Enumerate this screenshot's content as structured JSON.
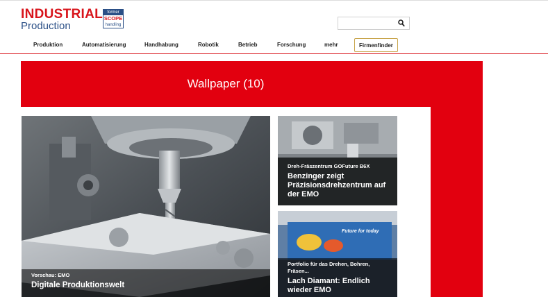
{
  "header": {
    "logo": {
      "line1": "INDUSTRIAL",
      "line2": "Production",
      "badge_top": "former",
      "badge_mid": "SCOPE",
      "badge_bottom": "handling"
    },
    "search": {
      "placeholder": "",
      "icon": "search-icon"
    },
    "nav": [
      "Produktion",
      "Automatisierung",
      "Handhabung",
      "Robotik",
      "Betrieb",
      "Forschung",
      "mehr"
    ],
    "firmenfinder_label": "Firmenfinder"
  },
  "section": {
    "title": "Wallpaper (10)"
  },
  "cards": {
    "main": {
      "kicker": "Vorschau: EMO",
      "headline": "Digitale Produktionswelt"
    },
    "top": {
      "kicker": "Dreh-Fräszentrum GOFuture B6X",
      "headline": "Benzinger zeigt Präzisionsdrehzentrum auf der EMO"
    },
    "bottom": {
      "kicker": "Portfolio für das Drehen, Bohren, Fräsen...",
      "headline": "Lach Diamant: Endlich wieder EMO",
      "banner_text": "Future for today"
    }
  },
  "colors": {
    "brand_red": "#e2000f",
    "logo_blue": "#2a4f86",
    "button_border": "#c8a44a"
  }
}
